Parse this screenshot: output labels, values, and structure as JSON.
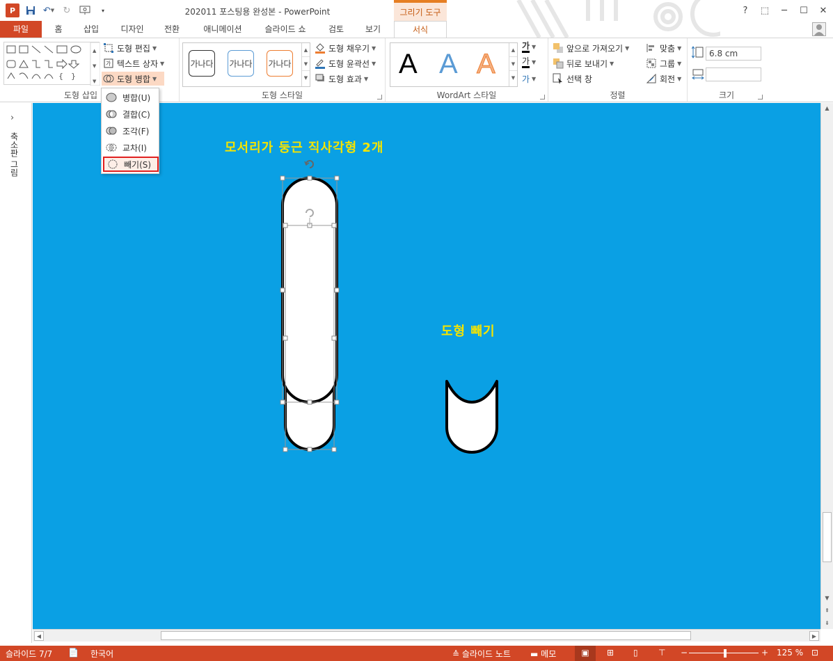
{
  "app": {
    "title": "202011 포스팅용 완성본 - PowerPoint",
    "context_tab_header": "그리기 도구",
    "help": "?",
    "win_restore_ribbon": "⬚",
    "win_min": "─",
    "win_max": "☐",
    "win_close": "✕"
  },
  "tabs": [
    {
      "label": "파일"
    },
    {
      "label": "홈"
    },
    {
      "label": "삽입"
    },
    {
      "label": "디자인"
    },
    {
      "label": "전환"
    },
    {
      "label": "애니메이션"
    },
    {
      "label": "슬라이드 쇼"
    },
    {
      "label": "검토"
    },
    {
      "label": "보기"
    },
    {
      "label": "서식"
    }
  ],
  "ribbon": {
    "insert_shapes": {
      "label": "도형 삽입",
      "edit_shape": "도형 편집",
      "text_box": "텍스트 상자",
      "merge_shapes": "도형 병합"
    },
    "shape_styles": {
      "label": "도형 스타일",
      "thumb_text": "가나다",
      "fill": "도형 채우기",
      "outline": "도형 윤곽선",
      "effects": "도형 효과"
    },
    "wordart": {
      "label": "WordArt 스타일",
      "letter": "A",
      "text_fill_icon": "가",
      "text_outline_icon": "가"
    },
    "arrange": {
      "label": "정렬",
      "bring_forward": "앞으로 가져오기",
      "send_backward": "뒤로 보내기",
      "selection_pane": "선택 창",
      "align": "맞춤",
      "group": "그룹",
      "rotate": "회전"
    },
    "size": {
      "label": "크기",
      "height_value": "6.8 cm",
      "width_value": ""
    }
  },
  "merge_menu": {
    "items": [
      {
        "label": "병합(U)"
      },
      {
        "label": "결합(C)"
      },
      {
        "label": "조각(F)"
      },
      {
        "label": "교차(I)"
      },
      {
        "label": "빼기(S)"
      }
    ]
  },
  "left_pane": {
    "label": "축소판 그림"
  },
  "slide": {
    "background": "#0aa0e4",
    "title_left": "모서리가 둥근 직사각형 2개",
    "title_right": "도형 빼기"
  },
  "status": {
    "slide_num": "슬라이드 7/7",
    "language": "한국어",
    "notes": "슬라이드 노트",
    "comments": "메모",
    "zoom": "125 %"
  }
}
